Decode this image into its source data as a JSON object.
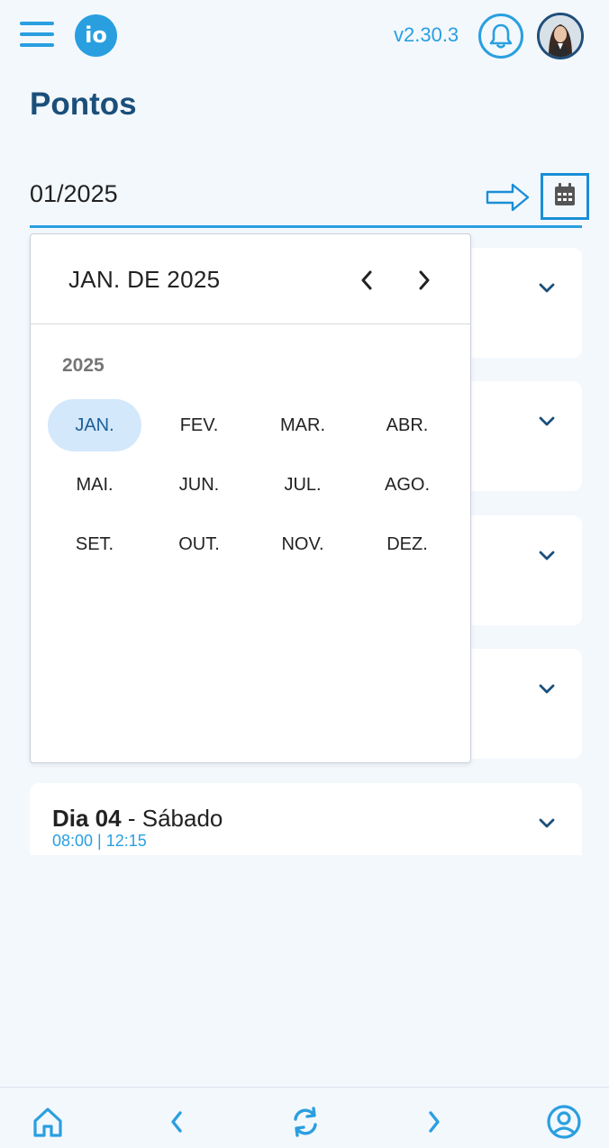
{
  "header": {
    "logo_text": "io",
    "version": "v2.30.3"
  },
  "page": {
    "title": "Pontos"
  },
  "month_field": {
    "value": "01/2025"
  },
  "day_cards": [
    {
      "day_label": "Dia 04",
      "weekday": "- Sábado",
      "times": "08:00 | 12:15"
    }
  ],
  "picker": {
    "title": "JAN. DE 2025",
    "year": "2025",
    "months": [
      "JAN.",
      "FEV.",
      "MAR.",
      "ABR.",
      "MAI.",
      "JUN.",
      "JUL.",
      "AGO.",
      "SET.",
      "OUT.",
      "NOV.",
      "DEZ."
    ],
    "selected": "JAN."
  },
  "colors": {
    "accent": "#2a9fe0",
    "title": "#1b4f7b",
    "background": "#f3f8fd",
    "selected_month": "#d3e8fb"
  },
  "icons": {
    "menu": "hamburger-icon",
    "notifications": "bell-icon",
    "calendar": "calendar-icon",
    "home": "home-icon",
    "prev": "chevron-left-icon",
    "refresh": "refresh-icon",
    "next": "chevron-right-icon",
    "profile": "user-circle-icon"
  }
}
